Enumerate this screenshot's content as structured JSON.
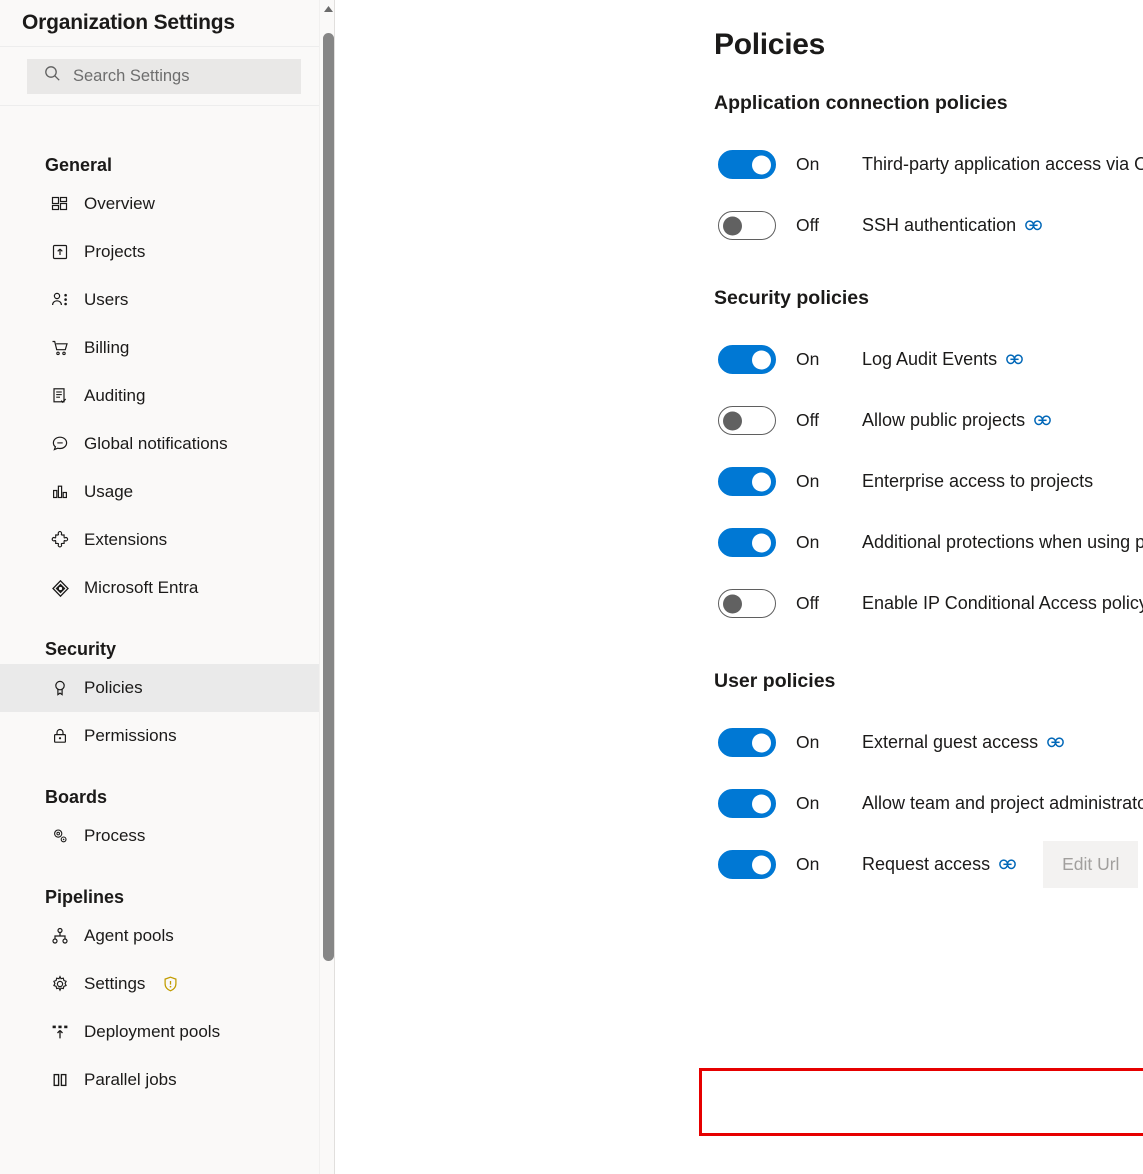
{
  "sidebar": {
    "title": "Organization Settings",
    "search": {
      "placeholder": "Search Settings",
      "icon": "search-icon",
      "value": ""
    },
    "groups": [
      {
        "label": "General",
        "items": [
          {
            "label": "Overview",
            "icon": "overview-icon"
          },
          {
            "label": "Projects",
            "icon": "projects-icon"
          },
          {
            "label": "Users",
            "icon": "users-icon"
          },
          {
            "label": "Billing",
            "icon": "billing-cart-icon"
          },
          {
            "label": "Auditing",
            "icon": "auditing-icon"
          },
          {
            "label": "Global notifications",
            "icon": "notifications-icon"
          },
          {
            "label": "Usage",
            "icon": "usage-chart-icon"
          },
          {
            "label": "Extensions",
            "icon": "extensions-puzzle-icon"
          },
          {
            "label": "Microsoft Entra",
            "icon": "microsoft-entra-icon"
          }
        ]
      },
      {
        "label": "Security",
        "items": [
          {
            "label": "Policies",
            "icon": "policies-ribbon-icon",
            "selected": true
          },
          {
            "label": "Permissions",
            "icon": "permissions-lock-icon"
          }
        ]
      },
      {
        "label": "Boards",
        "items": [
          {
            "label": "Process",
            "icon": "process-gears-icon"
          }
        ]
      },
      {
        "label": "Pipelines",
        "items": [
          {
            "label": "Agent pools",
            "icon": "agent-pools-icon"
          },
          {
            "label": "Settings",
            "icon": "settings-gear-icon",
            "warning": "shield-warning-icon"
          },
          {
            "label": "Deployment pools",
            "icon": "deployment-pools-icon"
          },
          {
            "label": "Parallel jobs",
            "icon": "parallel-jobs-icon"
          }
        ]
      }
    ],
    "scrollbar": {
      "up_arrow": "scroll-up-arrow-icon"
    }
  },
  "main": {
    "title": "Policies",
    "sections": [
      {
        "heading": "Application connection policies",
        "policies": [
          {
            "state": "On",
            "on": true,
            "label": "Third-party application access via OAuth",
            "link": true
          },
          {
            "state": "Off",
            "on": false,
            "label": "SSH authentication",
            "link": true
          }
        ]
      },
      {
        "heading": "Security policies",
        "policies": [
          {
            "state": "On",
            "on": true,
            "label": "Log Audit Events",
            "link": true
          },
          {
            "state": "Off",
            "on": false,
            "label": "Allow public projects",
            "link": true
          },
          {
            "state": "On",
            "on": true,
            "label": "Enterprise access to projects",
            "link": false
          },
          {
            "state": "On",
            "on": true,
            "label": "Additional protections when using public package registries",
            "link": true
          },
          {
            "state": "Off",
            "on": false,
            "label": "Enable IP Conditional Access policy validation",
            "link": true
          }
        ]
      },
      {
        "heading": "User policies",
        "policies": [
          {
            "state": "On",
            "on": true,
            "label": "External guest access",
            "link": true
          },
          {
            "state": "On",
            "on": true,
            "label": "Allow team and project administrators to invite new users",
            "link": true
          },
          {
            "state": "On",
            "on": true,
            "label": "Request access",
            "link": true,
            "button": "Edit Url",
            "highlighted": true
          }
        ]
      }
    ]
  },
  "colors": {
    "toggle_on": "#0078d4",
    "link_icon": "#0067b8",
    "highlight_border": "#e60000",
    "sidebar_bg": "#faf9f8",
    "selected_item_bg": "#eaeaea",
    "warning_shield": "#c19c00"
  }
}
